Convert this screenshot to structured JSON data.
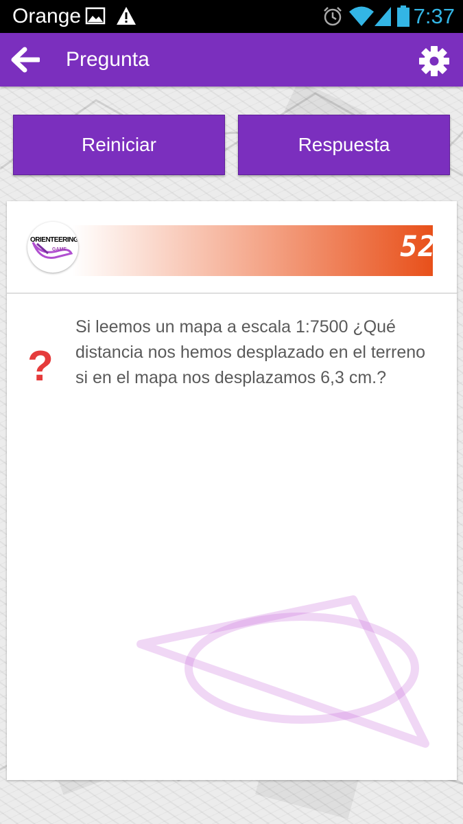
{
  "status_bar": {
    "carrier": "Orange",
    "time": "7:37",
    "icons": [
      "image-icon",
      "warning-icon",
      "alarm-icon",
      "wifi-icon",
      "signal-icon",
      "battery-icon"
    ]
  },
  "app_bar": {
    "title": "Pregunta",
    "back_icon": "back-arrow-icon",
    "settings_icon": "gear-icon"
  },
  "actions": {
    "reset_label": "Reiniciar",
    "answer_label": "Respuesta"
  },
  "question": {
    "logo_text": "ORIENTEERING",
    "logo_sub": "GAME",
    "number": "52",
    "text": "Si leemos un mapa a escala 1:7500 ¿Qué distancia nos hemos desplazado en el terreno si en el mapa nos desplazamos 6,3 cm.?",
    "icon_glyph": "?"
  },
  "colors": {
    "primary": "#7b2fbe",
    "accent": "#e8501a",
    "question_mark": "#e53b3b",
    "clock": "#33b5e5"
  }
}
